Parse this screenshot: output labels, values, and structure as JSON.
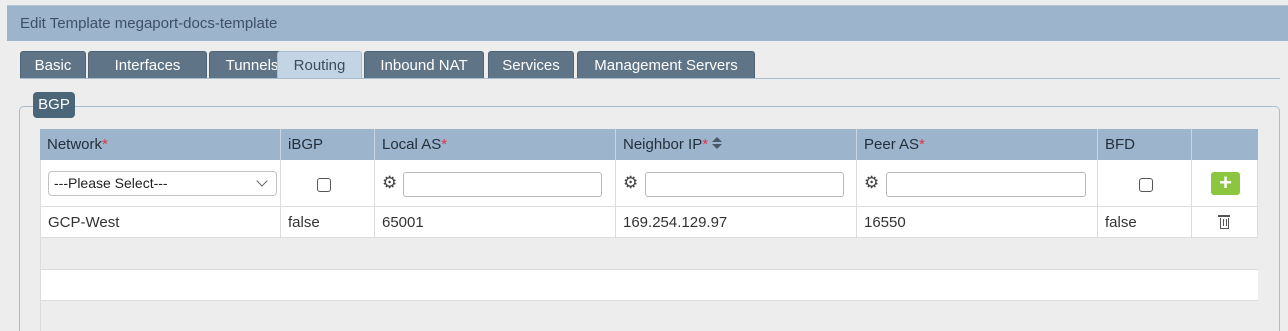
{
  "window": {
    "title": "Edit Template megaport-docs-template"
  },
  "tabs": [
    {
      "label": "Basic"
    },
    {
      "label": "Interfaces"
    },
    {
      "label": "Tunnels"
    },
    {
      "label": "Routing",
      "active": true
    },
    {
      "label": "Inbound NAT"
    },
    {
      "label": "Services"
    },
    {
      "label": "Management Servers"
    }
  ],
  "section": {
    "legend": "BGP"
  },
  "grid": {
    "columns": [
      {
        "label": "Network",
        "required": "*"
      },
      {
        "label": "iBGP"
      },
      {
        "label": "Local AS",
        "required": "*"
      },
      {
        "label": "Neighbor IP",
        "required": "*",
        "sortable": true
      },
      {
        "label": "Peer AS",
        "required": "*"
      },
      {
        "label": "BFD"
      }
    ],
    "filters": {
      "network_select": "---Please Select---",
      "local_as_value": "",
      "neighbor_ip_value": "",
      "peer_as_value": "",
      "ibgp_checked": false,
      "bfd_checked": false,
      "add_icon": "plus-icon",
      "settings_icon": "gear-icon"
    },
    "rows": [
      {
        "network": "GCP-West",
        "ibgp": "false",
        "local_as": "65001",
        "neighbor_ip": "169.254.129.97",
        "peer_as": "16550",
        "bfd": "false",
        "delete_icon": "trash-icon"
      }
    ]
  },
  "colors": {
    "titlebar": "#9cb4cc",
    "tab": "#5f7486",
    "tab_active": "#c3d4e4",
    "legend": "#4a6678",
    "add_button": "#8cc63f",
    "required": "#e0344a"
  }
}
